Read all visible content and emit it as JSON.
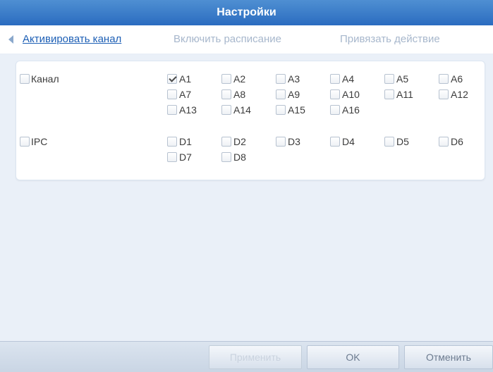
{
  "title": "Настройки",
  "tabs": [
    {
      "label": "Активировать канал",
      "active": true
    },
    {
      "label": "Включить расписание",
      "active": false
    },
    {
      "label": "Привязать действие",
      "active": false
    }
  ],
  "rows": {
    "analog": {
      "label": "Канал",
      "checked": false,
      "channels": [
        {
          "label": "A1",
          "checked": true
        },
        {
          "label": "A2",
          "checked": false
        },
        {
          "label": "A3",
          "checked": false
        },
        {
          "label": "A4",
          "checked": false
        },
        {
          "label": "A5",
          "checked": false
        },
        {
          "label": "A6",
          "checked": false
        },
        {
          "label": "A7",
          "checked": false
        },
        {
          "label": "A8",
          "checked": false
        },
        {
          "label": "A9",
          "checked": false
        },
        {
          "label": "A10",
          "checked": false
        },
        {
          "label": "A11",
          "checked": false
        },
        {
          "label": "A12",
          "checked": false
        },
        {
          "label": "A13",
          "checked": false
        },
        {
          "label": "A14",
          "checked": false
        },
        {
          "label": "A15",
          "checked": false
        },
        {
          "label": "A16",
          "checked": false
        }
      ]
    },
    "ipc": {
      "label": "IPC",
      "checked": false,
      "channels": [
        {
          "label": "D1",
          "checked": false
        },
        {
          "label": "D2",
          "checked": false
        },
        {
          "label": "D3",
          "checked": false
        },
        {
          "label": "D4",
          "checked": false
        },
        {
          "label": "D5",
          "checked": false
        },
        {
          "label": "D6",
          "checked": false
        },
        {
          "label": "D7",
          "checked": false
        },
        {
          "label": "D8",
          "checked": false
        }
      ]
    }
  },
  "buttons": {
    "apply": "Применить",
    "ok": "OK",
    "cancel": "Отменить"
  },
  "colors": {
    "title_bar": "#2a6cc0",
    "active_tab": "#1d5fb5",
    "inactive_tab": "#a7b7cc",
    "content_bg": "#eaf0f8"
  },
  "icons": {
    "tab_scroll": "left-arrow-icon",
    "checkbox": "checkbox-icon",
    "checkmark": "checkmark-icon"
  }
}
